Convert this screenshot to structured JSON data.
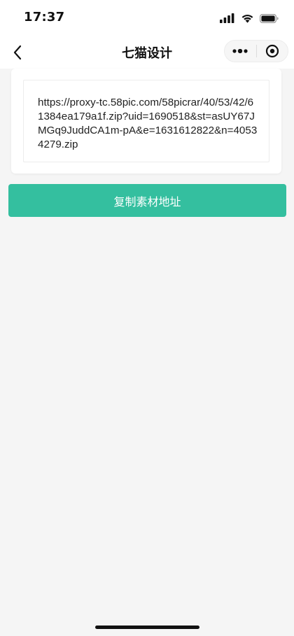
{
  "status_bar": {
    "time": "17:37",
    "icons": [
      "cellular-signal-icon",
      "wifi-icon",
      "battery-icon"
    ]
  },
  "nav": {
    "title": "七猫设计",
    "icons": [
      "chevron-left-icon",
      "more-dots-icon",
      "target-close-icon"
    ]
  },
  "content": {
    "url": "https://proxy-tc.58pic.com/58picrar/40/53/42/61384ea179a1f.zip?uid=1690518&st=asUY67JMGq9JuddCA1m-pA&e=1631612822&n=40534279.zip"
  },
  "actions": {
    "copy_label": "复制素材地址"
  },
  "colors": {
    "accent": "#34bf9f",
    "background": "#f5f5f5",
    "card": "#ffffff"
  }
}
